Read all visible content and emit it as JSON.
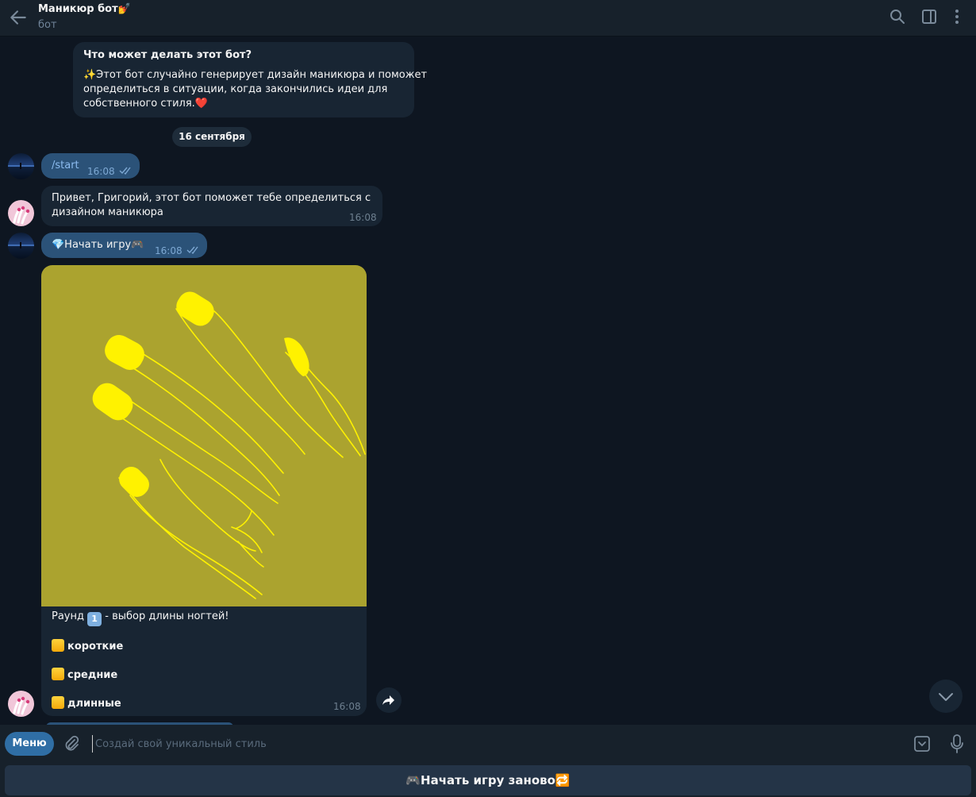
{
  "header": {
    "title": "Маникюр бот💅",
    "subtitle": "бот"
  },
  "bot_info": {
    "title": "Что может делать этот бот?",
    "line1": "✨Этот бот случайно генерирует дизайн маникюра и поможет",
    "line2": "определиться в ситуации, когда закончились идеи для",
    "line3": "собственного стиля.❤️"
  },
  "date_separator": "16 сентября",
  "messages": [
    {
      "text": "/start",
      "time": "16:08"
    },
    {
      "line1": "Привет, Григорий, этот бот поможет тебе определиться с",
      "line2": "дизайном маникюра",
      "time": "16:08"
    },
    {
      "text": "💎Начать игру🎮",
      "time": "16:08"
    },
    {
      "round_before": "Раунд ",
      "round_number": "1",
      "round_after": " - выбор длины ногтей!",
      "options": [
        "короткие",
        "средние",
        "длинные"
      ],
      "time": "16:08"
    }
  ],
  "input": {
    "menu_label": "Меню",
    "placeholder": "Создай свой уникальный стиль"
  },
  "keyboard": {
    "button_label": "🎮Начать игру заново🔁"
  },
  "colors": {
    "background": "#0e1621",
    "incoming_bubble": "#182533",
    "outgoing_bubble": "#2b5278",
    "accent": "#2f6ea5",
    "photo_background": "#aba32f",
    "nail_yellow": "#fff200"
  },
  "icons": [
    "back-arrow-icon",
    "search-icon",
    "sidebar-toggle-icon",
    "more-vertical-icon",
    "attach-icon",
    "keyboard-toggle-icon",
    "microphone-icon",
    "share-icon",
    "scroll-down-icon",
    "double-check-icon"
  ]
}
